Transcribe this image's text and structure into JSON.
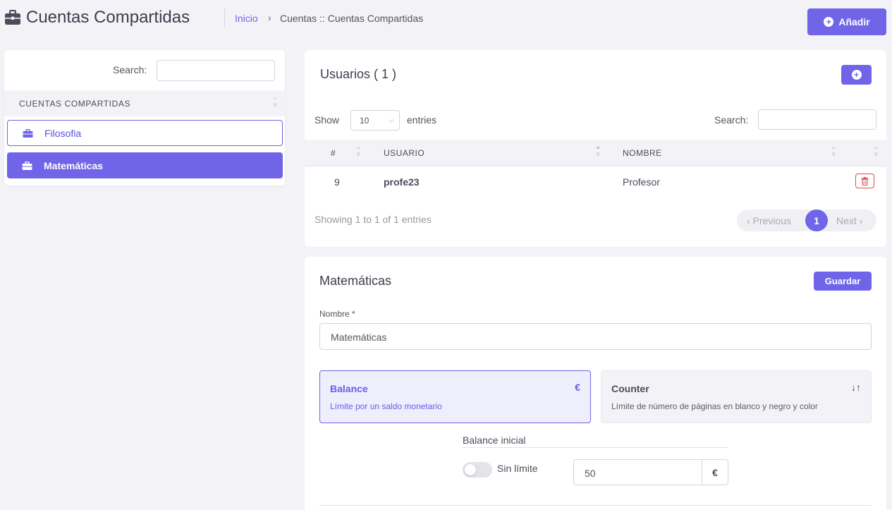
{
  "header": {
    "title": "Cuentas Compartidas",
    "breadcrumb": {
      "home": "Inicio",
      "separator": "›",
      "current": "Cuentas :: Cuentas Compartidas"
    },
    "add_label": "Añadir",
    "icon": "briefcase-icon"
  },
  "colors": {
    "accent": "#7064e8",
    "danger": "#e24a4a",
    "background": "#f3f3f7"
  },
  "accounts": {
    "search_label": "Search:",
    "search_value": "",
    "column_header": "CUENTAS COMPARTIDAS",
    "items": [
      {
        "label": "Filosofia",
        "icon": "briefcase-icon",
        "selected": false
      },
      {
        "label": "Matemáticas",
        "icon": "briefcase-icon",
        "selected": true
      }
    ]
  },
  "users": {
    "title": "Usuarios ( 1 )",
    "show_label": "Show",
    "entries_value": "10",
    "entries_label": "entries",
    "search_label": "Search:",
    "columns": [
      "#",
      "USUARIO",
      "NOMBRE"
    ],
    "rows": [
      {
        "id": "9",
        "usuario": "profe23",
        "nombre": "Profesor"
      }
    ],
    "info": "Showing 1 to 1 of 1 entries",
    "pagination": {
      "previous": "‹ Previous",
      "current_page": "1",
      "next": "Next ›"
    }
  },
  "edit": {
    "title": "Matemáticas",
    "save_label": "Guardar",
    "name_label": "Nombre *",
    "name_value": "Matemáticas",
    "options": [
      {
        "title": "Balance",
        "description": "Límite por un saldo monetario",
        "icon": "€",
        "selected": true
      },
      {
        "title": "Counter",
        "description": "Límite de número de páginas en blanco y negro y color",
        "icon": "↓↑",
        "selected": false
      }
    ],
    "balance_label": "Balance inicial",
    "no_limit_label": "Sin límite",
    "no_limit_enabled": false,
    "balance_value": "50",
    "currency": "€"
  }
}
